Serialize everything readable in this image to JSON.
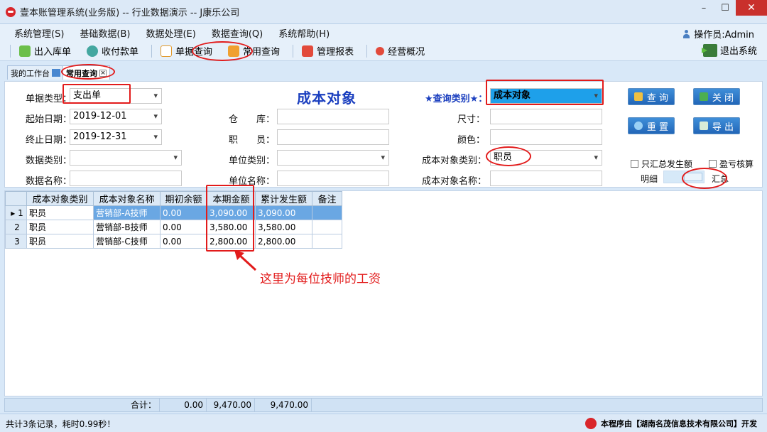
{
  "window": {
    "title": "壹本账管理系统(业务版) -- 行业数据演示 -- J康乐公司",
    "min": "–",
    "max": "☐",
    "close": "✕"
  },
  "menu": [
    "系统管理(S)",
    "基础数据(B)",
    "数据处理(E)",
    "数据查询(Q)",
    "系统帮助(H)"
  ],
  "operator": "操作员:Admin",
  "toolbar": {
    "items": [
      "出入库单",
      "收付款单",
      "单据查询",
      "常用查询",
      "管理报表",
      "经营概况"
    ],
    "exit": "退出系统"
  },
  "tabs": {
    "workbench": "我的工作台",
    "active": "常用查询"
  },
  "form": {
    "title": "成本对象",
    "doc_type_label": "单据类型：",
    "doc_type_value": "支出单",
    "start_date_label": "起始日期：",
    "start_date_value": "2019-12-01",
    "end_date_label": "终止日期：",
    "end_date_value": "2019-12-31",
    "data_type_label": "数据类别：",
    "data_name_label": "数据名称：",
    "warehouse_label": "仓　　库：",
    "staff_label": "职　　员：",
    "unit_type_label": "单位类别：",
    "unit_name_label": "单位名称：",
    "query_type_label": "★查询类别★：",
    "query_type_value": "成本对象",
    "size_label": "尺寸：",
    "color_label": "颜色：",
    "cost_obj_type_label": "成本对象类别：",
    "cost_obj_type_value": "职员",
    "cost_obj_name_label": "成本对象名称：",
    "btn_query": "查 询",
    "btn_close": "关 闭",
    "btn_reset": "重 置",
    "btn_export": "导 出",
    "chk_summary": "只汇总发生额",
    "chk_profit": "盈亏核算",
    "detail": "明细",
    "total": "汇总"
  },
  "grid": {
    "columns": [
      "成本对象类别",
      "成本对象名称",
      "期初余额",
      "本期金额",
      "累计发生额",
      "备注"
    ],
    "rows": [
      {
        "idx": "1",
        "marker": "▸",
        "type": "职员",
        "name": "营销部-A技师",
        "opening": "0.00",
        "current": "3,090.00",
        "cumulative": "3,090.00",
        "note": ""
      },
      {
        "idx": "2",
        "marker": "",
        "type": "职员",
        "name": "营销部-B技师",
        "opening": "0.00",
        "current": "3,580.00",
        "cumulative": "3,580.00",
        "note": ""
      },
      {
        "idx": "3",
        "marker": "",
        "type": "职员",
        "name": "营销部-C技师",
        "opening": "0.00",
        "current": "2,800.00",
        "cumulative": "2,800.00",
        "note": ""
      }
    ],
    "footer": {
      "label": "合计：",
      "opening": "0.00",
      "current": "9,470.00",
      "cumulative": "9,470.00"
    }
  },
  "annotation": "这里为每位技师的工资",
  "status": "共计3条记录，耗时0.99秒！",
  "credit": "本程序由【湖南名茂信息技术有限公司】开发"
}
